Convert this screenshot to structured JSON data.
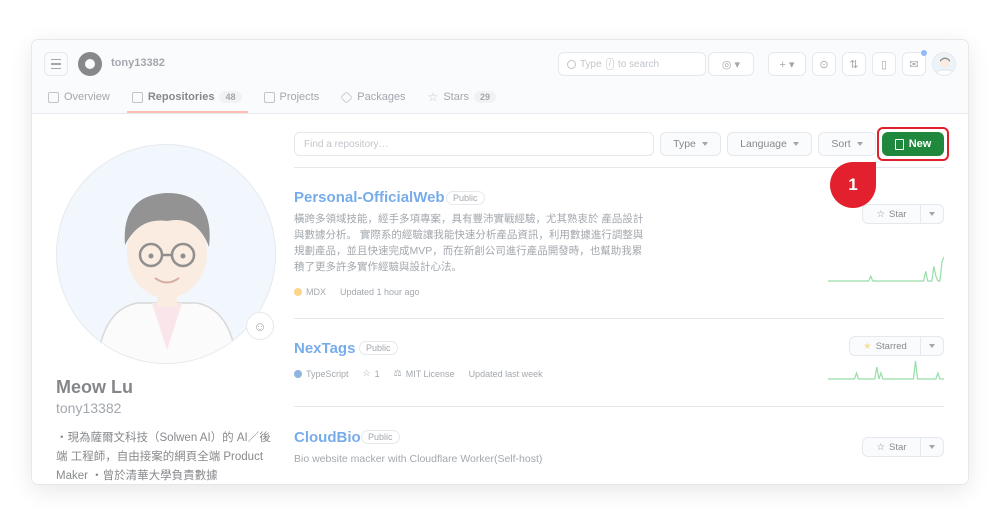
{
  "header": {
    "username": "tony13382",
    "search_placeholder": "Type",
    "search_kbd": "/",
    "search_suffix": "to search"
  },
  "tabs": [
    {
      "label": "Overview"
    },
    {
      "label": "Repositories",
      "count": "48"
    },
    {
      "label": "Projects"
    },
    {
      "label": "Packages"
    },
    {
      "label": "Stars",
      "count": "29"
    }
  ],
  "profile": {
    "name": "Meow Lu",
    "login": "tony13382",
    "bio": "・現為薩爾文科技（Solwen AI）的 AI／後端 工程師，自由接案的網頁全端 Product Maker ・曾於清華大學負責數據"
  },
  "filters": {
    "find_placeholder": "Find a repository…",
    "type_label": "Type",
    "language_label": "Language",
    "sort_label": "Sort",
    "new_label": "New"
  },
  "annotation": {
    "step": "1"
  },
  "repos": [
    {
      "name": "Personal-OfficialWeb",
      "visibility": "Public",
      "description": "橫跨多領域技能，經手多項專案，具有豐沛實戰經驗，尤其熟衷於 產品設計與數據分析。 實際系的經驗讓我能快速分析產品資訊，利用數據進行調整與規劃產品，並且快速完成MVP，而在新創公司進行產品開發時，也幫助我累積了更多許多實作經驗與設計心法。",
      "language": "MDX",
      "language_color": "#fcb32c",
      "updated": "Updated 1 hour ago",
      "star_label": "Star",
      "spark": [
        0,
        0,
        0,
        0,
        0,
        0,
        0,
        0,
        0,
        0,
        0,
        0,
        0,
        0,
        0,
        0,
        0,
        0,
        0,
        0,
        0,
        1,
        0,
        0,
        0,
        0,
        0,
        0,
        0,
        0,
        0,
        0,
        0,
        0,
        0,
        0,
        0,
        0,
        0,
        0,
        0,
        0,
        0,
        0,
        0,
        0,
        0,
        0,
        2,
        0,
        0,
        0,
        3,
        1,
        0,
        0,
        4,
        5
      ]
    },
    {
      "name": "NexTags",
      "visibility": "Public",
      "language": "TypeScript",
      "language_color": "#3178c6",
      "stars": "1",
      "license": "MIT License",
      "updated": "Updated last week",
      "star_label": "Starred",
      "spark": [
        0,
        0,
        0,
        0,
        0,
        0,
        0,
        0,
        0,
        0,
        0,
        0,
        0,
        0,
        1,
        0,
        0,
        0,
        0,
        0,
        0,
        0,
        0,
        0,
        2,
        0,
        1,
        0,
        0,
        0,
        0,
        0,
        0,
        0,
        0,
        0,
        0,
        0,
        0,
        0,
        0,
        0,
        0,
        3,
        0,
        0,
        0,
        0,
        0,
        0,
        0,
        0,
        0,
        0,
        1,
        0,
        0,
        0
      ]
    },
    {
      "name": "CloudBio",
      "visibility": "Public",
      "description": "Bio website macker with Cloudflare Worker(Self-host)",
      "star_label": "Star"
    }
  ]
}
